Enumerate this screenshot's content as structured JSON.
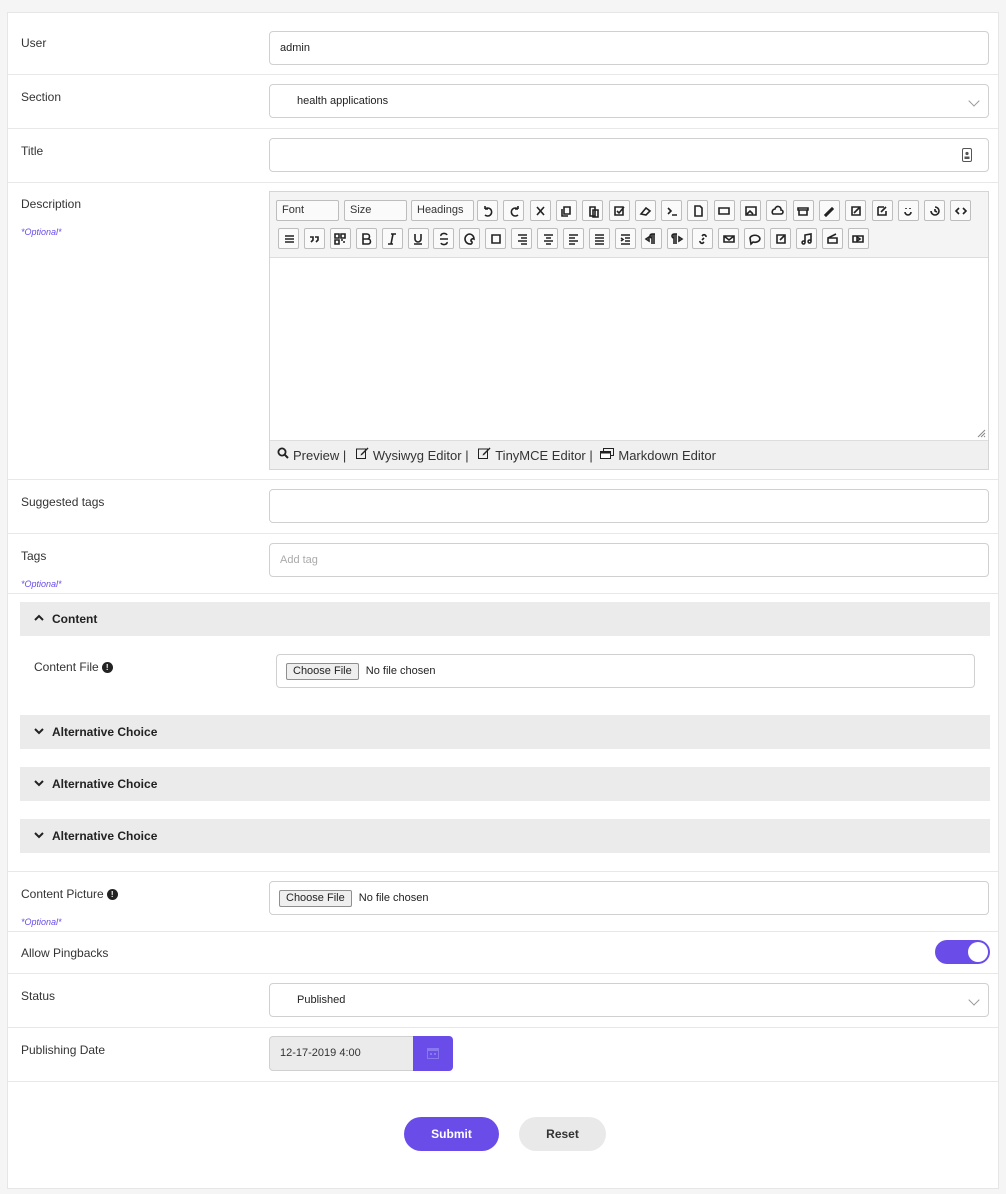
{
  "form": {
    "user": {
      "label": "User",
      "value": "admin"
    },
    "section": {
      "label": "Section",
      "value": "health applications"
    },
    "title": {
      "label": "Title",
      "value": ""
    },
    "description": {
      "label": "Description",
      "optional": "*Optional*"
    },
    "suggested_tags": {
      "label": "Suggested tags",
      "value": ""
    },
    "tags": {
      "label": "Tags",
      "optional": "*Optional*",
      "placeholder": "Add tag"
    },
    "content_picture": {
      "label": "Content Picture",
      "optional": "*Optional*",
      "button": "Choose File",
      "status": "No file chosen"
    },
    "allow_pingbacks": {
      "label": "Allow Pingbacks",
      "enabled": true
    },
    "status": {
      "label": "Status",
      "value": "Published"
    },
    "publishing_date": {
      "label": "Publishing Date",
      "value": "12-17-2019 4:00"
    }
  },
  "editor": {
    "toolbar_text_buttons": [
      "Font",
      "Size",
      "Headings"
    ],
    "toolbar_icons_row1": [
      "undo-icon",
      "redo-icon",
      "cut-icon",
      "copy-icon",
      "paste-icon",
      "checkbox-icon",
      "eraser-icon",
      "terminal-icon",
      "file-icon",
      "rectangle-icon",
      "image-icon",
      "cloud-upload-icon",
      "archive-icon",
      "pencil-icon",
      "edit-icon",
      "edit-square-icon",
      "smile-icon",
      "history-icon",
      "code-icon"
    ],
    "toolbar_icons_row2": [
      "list-icon",
      "quote-icon",
      "qrcode-icon",
      "bold-icon",
      "italic-icon",
      "underline-icon",
      "strikethrough-icon",
      "palette-icon",
      "square-icon",
      "align-right-icon",
      "align-center-icon",
      "align-left-icon",
      "justify-icon",
      "indent-icon",
      "ltr-icon",
      "rtl-icon",
      "link-icon",
      "envelope-icon",
      "comment-icon",
      "external-icon",
      "music-icon",
      "film-icon",
      "video-icon"
    ],
    "footer": {
      "preview": "Preview |",
      "wysiwyg": "Wysiwyg Editor |",
      "tinymce": "TinyMCE Editor |",
      "markdown": "Markdown Editor"
    }
  },
  "panels": {
    "content": {
      "title": "Content",
      "expanded": true,
      "file_label": "Content File",
      "button": "Choose File",
      "status": "No file chosen"
    },
    "alternatives": [
      "Alternative Choice",
      "Alternative Choice",
      "Alternative Choice"
    ]
  },
  "actions": {
    "submit": "Submit",
    "reset": "Reset"
  },
  "colors": {
    "accent": "#6a4de8",
    "panel_bg": "#ebebeb",
    "optional_text": "#6a4de8"
  }
}
